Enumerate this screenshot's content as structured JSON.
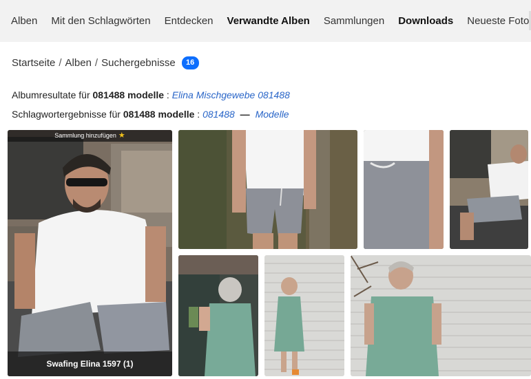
{
  "nav": {
    "items": [
      {
        "label": "Alben",
        "bold": false
      },
      {
        "label": "Mit den Schlagwörten",
        "bold": false
      },
      {
        "label": "Entdecken",
        "bold": false
      },
      {
        "label": "Verwandte Alben",
        "bold": true
      },
      {
        "label": "Sammlungen",
        "bold": false
      },
      {
        "label": "Downloads",
        "bold": true
      },
      {
        "label": "Neueste Fotos",
        "bold": false
      }
    ]
  },
  "breadcrumb": {
    "items": [
      "Startseite",
      "Alben",
      "Suchergebnisse"
    ],
    "divider": "/",
    "count": "16"
  },
  "album_results": {
    "prefix": "Albumresultate für",
    "query": "081488 modelle",
    "colon": ":",
    "link": "Elina Mischgewebe 081488"
  },
  "tag_results": {
    "prefix": "Schlagwortergebnisse für",
    "query": "081488 modelle",
    "colon": ":",
    "link1": "081488",
    "dash": "—",
    "link2": "Modelle"
  },
  "tiles": {
    "featured": {
      "top_label": "Sammlung hinzufügen",
      "star_icon": "★",
      "caption": "Swafing Elina 1597 (1)"
    }
  },
  "colors": {
    "link": "#2a66c8",
    "badge": "#0d6efd",
    "nav_bg": "#f2f2f2"
  }
}
